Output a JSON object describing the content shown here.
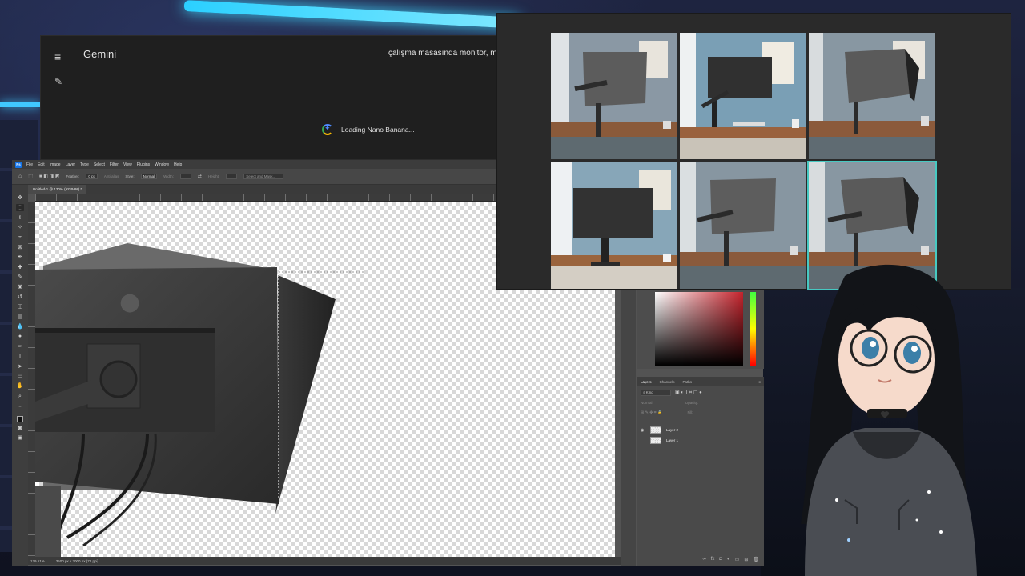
{
  "gemini": {
    "title": "Gemini",
    "prompt_excerpt": "çalışma masasında monitör, mor",
    "loading_text": "Loading Nano Banana..."
  },
  "photoshop": {
    "menu": [
      "File",
      "Edit",
      "Image",
      "Layer",
      "Type",
      "Select",
      "Filter",
      "View",
      "Plugins",
      "Window",
      "Help"
    ],
    "options": {
      "feather_label": "Feather:",
      "feather_value": "0 px",
      "antialias_label": "Anti-alias",
      "style_label": "Style:",
      "style_value": "Normal",
      "width_label": "Width:",
      "height_label": "Height:",
      "select_mask_label": "Select and Mask..."
    },
    "document_tab": "Untitled-1 @ 130% (RGB/8#) *",
    "status": {
      "zoom": "129.61%",
      "doc_info": "3500 px x 3000 px (72 ppi)"
    },
    "layers_panel": {
      "tabs": [
        "Layers",
        "Channels",
        "Paths"
      ],
      "filter_kind": "Kind",
      "blend_mode": "Normal",
      "opacity_label": "Opacity:",
      "fill_label": "Fill:",
      "layers": [
        {
          "name": "Layer 2",
          "visible": true
        },
        {
          "name": "Layer 1",
          "visible": false
        }
      ]
    },
    "colors": {
      "foreground": "#111111",
      "picker_hue": "#c5232c"
    }
  },
  "image_grid": {
    "count": 6,
    "selected_index": 5,
    "accent": "#47c9c2"
  }
}
